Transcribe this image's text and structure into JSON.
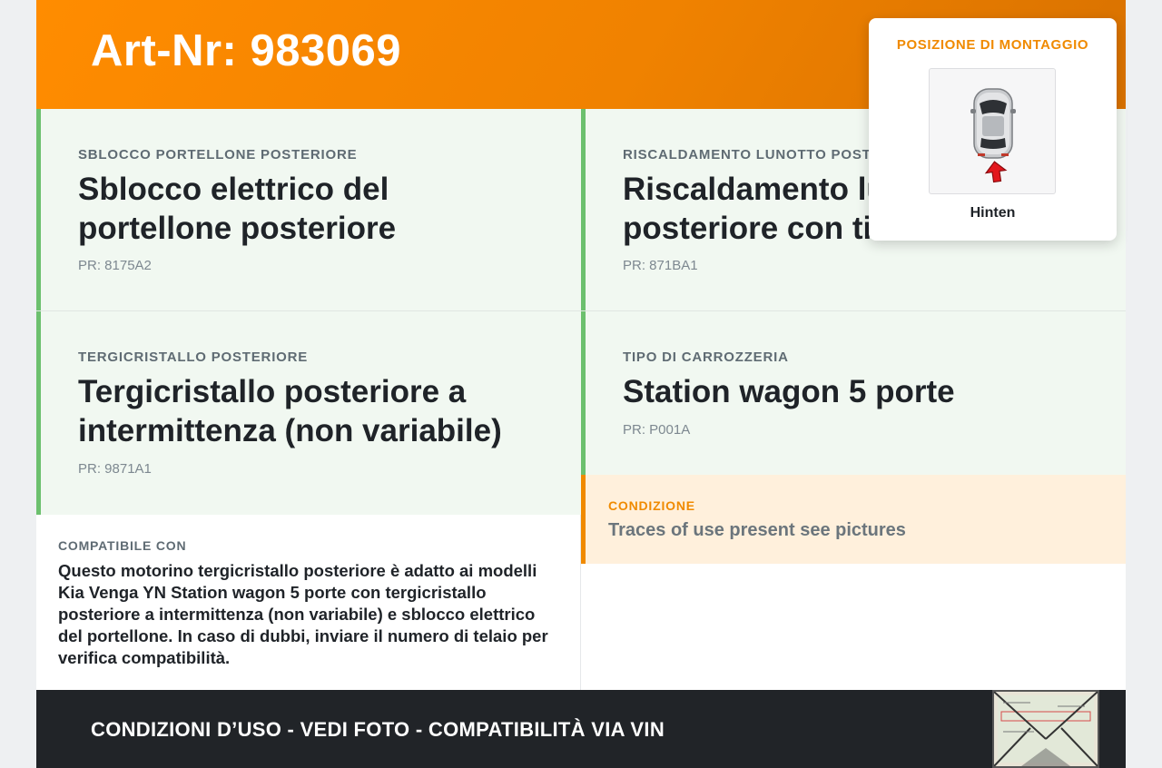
{
  "header": {
    "title": "Art-Nr: 983069"
  },
  "cards": [
    {
      "label": "SBLOCCO PORTELLONE POSTERIORE",
      "value": "Sblocco elettrico del portellone posteriore",
      "pr": "PR: 8175A2"
    },
    {
      "label": "RISCALDAMENTO LUNOTTO POSTERIORE",
      "value": "Riscaldamento lunotto posteriore con timer",
      "pr": "PR: 871BA1"
    },
    {
      "label": "TERGICRISTALLO POSTERIORE",
      "value": "Tergicristallo posteriore a intermittenza (non variabile)",
      "pr": "PR: 9871A1"
    },
    {
      "label": "TIPO DI CARROZZERIA",
      "value": "Station wagon 5 porte",
      "pr": "PR: P001A"
    }
  ],
  "compatibility": {
    "label": "COMPATIBILE CON",
    "text": "Questo motorino tergicristallo posteriore è adatto ai modelli Kia Venga YN Station wagon 5 porte con tergicristallo posteriore a intermittenza (non variabile) e sblocco elettrico del portellone. In caso di dubbi, inviare il numero di telaio per verifica compatibilità."
  },
  "condition": {
    "label": "CONDIZIONE",
    "text": "Traces of use present see pictures"
  },
  "footer": {
    "text": "CONDIZIONI D’USO - VEDI FOTO - COMPATIBILITÀ VIA VIN"
  },
  "mounting_popup": {
    "title": "POSIZIONE DI MONTAGGIO",
    "position": "Hinten",
    "icon": "car-rear-arrow-icon"
  },
  "colors": {
    "accent": "#f08a00",
    "card_border": "#6cc06e",
    "card_bg": "#f1f8f1",
    "condition_bg": "#fff0dc",
    "footer_bg": "#212428"
  }
}
